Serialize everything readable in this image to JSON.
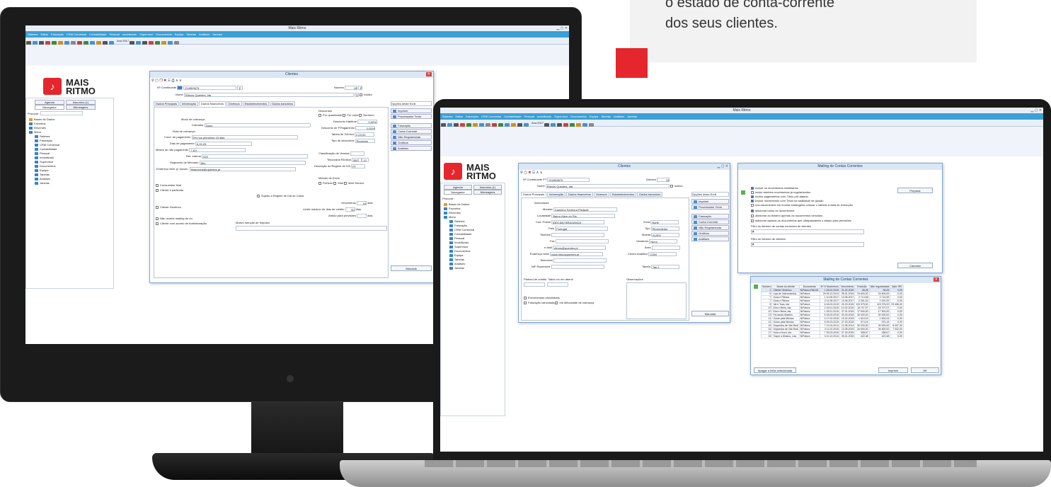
{
  "promo": {
    "line1": "o estado de conta-corrente",
    "line2": "dos seus clientes."
  },
  "app": {
    "title": "Mais Ritmo",
    "menu": [
      "Sistema",
      "Editar",
      "Faturação",
      "CRM Comercial",
      "Contabilidade",
      "Pessoal",
      "Imobilizado",
      "Supervisor",
      "Documentos",
      "Equipa",
      "Tabelas",
      "Análises",
      "Janelas"
    ],
    "year_label": "Ano:2017",
    "logo_line1": "MAIS",
    "logo_line2": "RITMO",
    "sidebar_tabs": [
      "Agenda",
      "Assuntos (1)",
      "Navegador",
      "Mensagens"
    ],
    "search_label": "Procurar :",
    "tree": [
      "Bases de Dados",
      "Favoritos",
      "Recentes",
      "Menu",
      "Sistema",
      "Faturação",
      "CRM Comercial",
      "Contabilidade",
      "Pessoal",
      "Imobilizado",
      "Supervisor",
      "Documentos",
      "Equipa",
      "Tabelas",
      "Análises",
      "Janelas"
    ]
  },
  "clientes": {
    "title": "Clientes",
    "contribuinte_label": "Nº Contribuinte",
    "country": "PT",
    "contribuinte": "214963675",
    "numero_label": "Número",
    "numero": "15",
    "nome_label": "Nome",
    "nome": "Ritmos Quentes, lda",
    "inativo": "Inativo",
    "opcoes": "Opções deste Ecrã",
    "tabs_monitor": [
      "Dados Principais",
      "Informação",
      "Dados financeiros",
      "Diversos",
      "Estabelecimentos",
      "Dados bancários"
    ],
    "tabs_laptop": [
      "Dados Principais",
      "Informação",
      "Dados financeiros",
      "Diversos",
      "Estabelecimentos",
      "Dados bancários"
    ],
    "side_buttons": [
      "Imprimir",
      "Processador Texto",
      "Faturação",
      "Conta Corrente",
      "Não Regularizada",
      "Gráficos",
      "Análises"
    ],
    "fin": {
      "modo_cobranca": "Modo de cobrança",
      "cobrador_label": "Cobrador",
      "cobrador": "Nuno",
      "rota": "Rota de cobrança",
      "cond_label": "Cond. de pagamento",
      "cond": "5% nos primeiros 15 dias",
      "dias_label": "Dias de pagamento",
      "dias": "5,15,25",
      "meses_label": "Meses de não pagamento",
      "meses": "7,8,9",
      "ref_label": "Ref. Interna",
      "ref": "003",
      "seg_label": "Segmento de Mercado",
      "seg": "Alto",
      "email_label": "Endereço eletr. p/ docum.",
      "email": "financeira@rquentes.pt",
      "descontos": "Descontos",
      "desc_opts": [
        "Por quantidade",
        "Por valor",
        "Nenhum"
      ],
      "desc_hab_label": "Desconto Habitual",
      "desc_hab": "0,00%",
      "desc_pag_label": "Desconto de P.Pagamento",
      "desc_pag": "0,00%",
      "tabela_iva_label": "Tabela de IVA fixa",
      "tabela_iva": "2-23,00",
      "tipo_desc_label": "Tipo de descontos",
      "tipo_desc": "Revenda",
      "class_label": "Classificação de Vendas",
      "tesouraria_label": "Tesouraria Recibos",
      "tesouraria": "BNT",
      "tesouraria_num": "12",
      "regime_label": "Descrição do Regime de IVA",
      "regime": "PT",
      "envio_label": "Método de Envio",
      "envio_opts": [
        "Ficheiro",
        "Mail",
        "Web Service"
      ],
      "consumidor": "Consumidor final",
      "particular": "Cliente é particular",
      "sujeito": "Sujeito a Regime de IVA de Caixa",
      "generico": "Cliente Genérico",
      "venc_label": "Vencimento",
      "venc": "15",
      "dias_u": "dias",
      "limite_label": "Limite máximo de dias de crédito",
      "limite": "90",
      "atraso_label": "Atraso para previsões",
      "mailing": "Não recebe mailing de c/c",
      "acordo": "Cliente com acordo de Autofaturação",
      "isencao": "Motivo Isenção de Imposto",
      "marcada": "Marcada"
    },
    "main": {
      "abreviatura": "Abreviatura",
      "morada_label": "Morada",
      "morada": "Caminho Senhora Piedade",
      "localidade_label": "Localidade",
      "localidade": "Bairro Além do Rio",
      "cp_label": "Cód. Postal",
      "cp": "5300-680 BRAGANÇA",
      "pais_label": "País",
      "pais": "Portugal",
      "telefone": "Telefone",
      "fax": "Fax",
      "email_label": "e-Mail",
      "email": "ritmos@quentes.pt",
      "www_label": "Endereço www",
      "www": "www.ritmosquentes.pt",
      "telemovel": "Telemóvel",
      "nif": "NIF Represent.",
      "zona_label": "Zona",
      "zona": "Norte",
      "tipo_label": "Tipo",
      "tipo": "Revendedor",
      "moeda_label": "Moeda",
      "moeda": "EURO",
      "vendedor_label": "Vendedor",
      "vendedor": "Nuno",
      "area": "Área",
      "centro_label": "Centro Analítico",
      "centro": "COM",
      "tabela_label": "Tabela",
      "tabela": "Tab.1",
      "plafond": "Plafond de crédito",
      "saldo": "Saldo c/c em aberto",
      "observacoes": "Observações",
      "encomendas": "Encomendas canceladas",
      "faturacao": "Faturação cancelada",
      "dificuldade": "em dificuldade de cobrança",
      "marcada": "Marcada"
    }
  },
  "mailing": {
    "title": "Mailing de Contas Correntes",
    "opts": [
      {
        "label": "excluir os movimentos imobiliários",
        "on": true
      },
      {
        "label": "incluir também movimentos já regularizados",
        "on": false
      },
      {
        "label": "excluir pagamentos com Título pré-datado",
        "on": true
      },
      {
        "label": "excluir movimentos com Título na totalidade de glosão",
        "on": true
      },
      {
        "label": "nos documentos em moeda estrangeira colocar o câmbio à data de execução",
        "on": false
      }
    ],
    "radio1": "adicionar todos os documentos",
    "radio2": "adicionar ao ficheiro apenas os documentos vencidos",
    "radio3": "adicionar apenas os documentos que ultrapassaram o atraso para previsões",
    "filtro1": "Filtro do ficheiro de contas correntes de clientes",
    "filtro2": "Filtro do ficheiro de clientes",
    "preparar": "Preparar",
    "cancelar": "Cancelar"
  },
  "mailing_table": {
    "title": "Mailing de Contas Correntes",
    "headers": [
      "Número",
      "Nome do cliente",
      "Documento",
      "Nº D Movimento",
      "Vencimento",
      "Emissão",
      "Não regularizada",
      "Valor IRS"
    ],
    "rows": [
      [
        "2",
        "Cliente Genérico",
        "N/Fatura R&U01",
        "1 25.02.2015",
        "21.02.2015",
        "36,26",
        "36,26",
        "0,00"
      ],
      [
        "6",
        "Loja de Instrumentos,",
        "N/Fatura",
        "24 06.12.2014",
        "05.01.2015",
        "24 600,00",
        "24 600,00",
        "0,00"
      ],
      [
        "7",
        "Sons e Ritmos",
        "N/Fatura",
        "1 10.06.2017",
        "13.06.2017",
        "2 714,59",
        "2 714,59",
        "0,00"
      ],
      [
        "7",
        "Sons e Ritmos",
        "N/Fatura",
        "2 11.06.2017",
        "13.06.2017",
        "2 291,00",
        "2 291,00",
        "0,00"
      ],
      [
        "8",
        "Vai e Toca, lda",
        "N/Fatura",
        "6 18.03.2015",
        "20.03.2015",
        "115 375,00",
        "115 375,00",
        "23 456,00"
      ],
      [
        "10",
        "Eira e Beira, lda",
        "N/Fatura",
        "2 15.01.2015",
        "14.02.2015",
        "16 707,07",
        "16 707,07",
        "0,00"
      ],
      [
        "10",
        "Eira e Beira, lda",
        "N/Fatura",
        "1 25.01.2015",
        "27.01.2015",
        "17 500,00",
        "17 500,00",
        "0,00"
      ],
      [
        "13",
        "Fernando Martins",
        "N/Fatura",
        "5 18.03.2015",
        "20.03.2015",
        "30 000,00",
        "30 000,00",
        "0,00"
      ],
      [
        "14",
        "Gosto pela Música",
        "N/Fatura",
        "4 17.02.2015",
        "19.02.2015",
        "1 624,03",
        "1 624,03",
        "0,00"
      ],
      [
        "14",
        "Gosto pela Música",
        "N/Fatura",
        "5 25.03.2015",
        "27.03.2015",
        "974,16",
        "974,16",
        "0,00"
      ],
      [
        "16",
        "Orquestra de Vila Real",
        "N/Fatura",
        "7 12.04.2014",
        "12.05.2014",
        "30 000,00",
        "30 000,00",
        "6 097,00"
      ],
      [
        "16",
        "Orquestra de Vila Real",
        "N/Fatura",
        "3 11.02.2015",
        "13.05.2015",
        "34 600,00",
        "34 600,00",
        "7 032,00"
      ],
      [
        "17",
        "Hora a Hora, lda",
        "N/Fatura",
        "7 25.03.2015",
        "27.03.2015",
        "338,67",
        "338,67",
        "0,00"
      ],
      [
        "18",
        "Toque a Música, Lda.",
        "N/Fatura",
        "3 10.12.2014",
        "09.01.2015",
        "422,48",
        "422,48",
        "0,00"
      ]
    ],
    "apagar": "Apagar a linha selecionada",
    "imprimir": "Imprimir",
    "ok": "OK"
  }
}
